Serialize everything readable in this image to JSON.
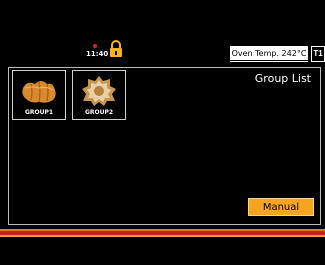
{
  "status_bar": {
    "time": "11:40",
    "oven_temp_label": "Oven Temp. 242°C",
    "tray_label": "T1"
  },
  "page": {
    "title": "Group List"
  },
  "groups": [
    {
      "label": "GROUP1",
      "icon": "croissant-icon"
    },
    {
      "label": "GROUP2",
      "icon": "donut-icon"
    }
  ],
  "buttons": {
    "manual_label": "Manual"
  },
  "colors": {
    "accent": "#f4a41e",
    "background": "#000000",
    "stripe_red": "#c81e1e",
    "stripe_orange": "#e07a1a"
  }
}
